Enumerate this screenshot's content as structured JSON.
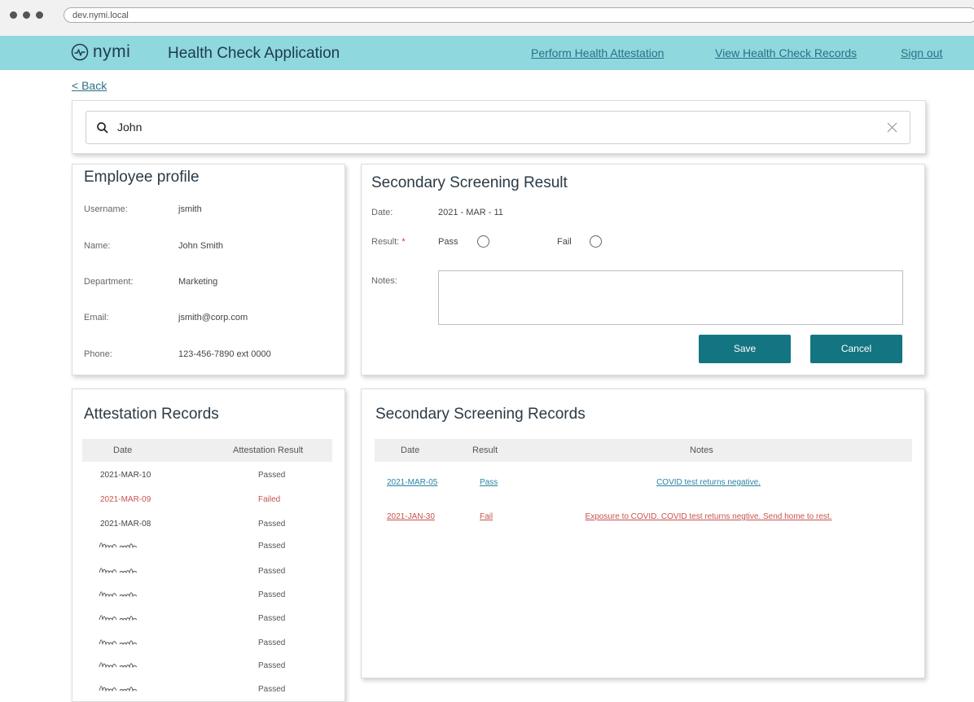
{
  "browser": {
    "url": "dev.nymi.local"
  },
  "header": {
    "logo_text": "nymi",
    "title": "Health Check Application",
    "nav": [
      "Perform Health Attestation",
      "View Health Check Records",
      "Sign out"
    ]
  },
  "back_link": "< Back",
  "search": {
    "value": "John"
  },
  "profile": {
    "title": "Employee profile",
    "fields": [
      {
        "label": "Username:",
        "value": "jsmith"
      },
      {
        "label": "Name:",
        "value": "John Smith"
      },
      {
        "label": "Department:",
        "value": "Marketing"
      },
      {
        "label": "Email:",
        "value": "jsmith@corp.com"
      },
      {
        "label": "Phone:",
        "value": "123-456-7890 ext 0000"
      }
    ]
  },
  "screening": {
    "title": "Secondary Screening Result",
    "date_label": "Date:",
    "date_value": "2021 - MAR - 11",
    "result_label": "Result:",
    "required_mark": "*",
    "pass_label": "Pass",
    "fail_label": "Fail",
    "notes_label": "Notes:",
    "save_label": "Save",
    "cancel_label": "Cancel"
  },
  "attestation": {
    "title": "Attestation Records",
    "columns": [
      "Date",
      "Attestation Result"
    ],
    "rows": [
      {
        "date": "2021-MAR-10",
        "result": "Passed",
        "status": "passed"
      },
      {
        "date": "2021-MAR-09",
        "result": "Failed",
        "status": "failed"
      },
      {
        "date": "2021-MAR-08",
        "result": "Passed",
        "status": "passed"
      },
      {
        "date": "",
        "result": "Passed",
        "status": "passed"
      },
      {
        "date": "",
        "result": "Passed",
        "status": "passed"
      },
      {
        "date": "",
        "result": "Passed",
        "status": "passed"
      },
      {
        "date": "",
        "result": "Passed",
        "status": "passed"
      },
      {
        "date": "",
        "result": "Passed",
        "status": "passed"
      },
      {
        "date": "",
        "result": "Passed",
        "status": "passed"
      },
      {
        "date": "",
        "result": "Passed",
        "status": "passed"
      }
    ]
  },
  "records": {
    "title": "Secondary Screening Records",
    "columns": [
      "Date",
      "Result",
      "Notes"
    ],
    "rows": [
      {
        "date": "2021-MAR-05",
        "result": "Pass",
        "notes": "COVID test returns negative.",
        "status": "pass"
      },
      {
        "date": "2021-JAN-30",
        "result": "Fail",
        "notes": "Exposure to COVID. COVID test returns negtive. Send home to rest.",
        "status": "fail"
      }
    ]
  },
  "colors": {
    "header_bg": "#8fd8dd",
    "accent": "#137581",
    "link": "#2c6f88",
    "fail": "#c7534f"
  }
}
